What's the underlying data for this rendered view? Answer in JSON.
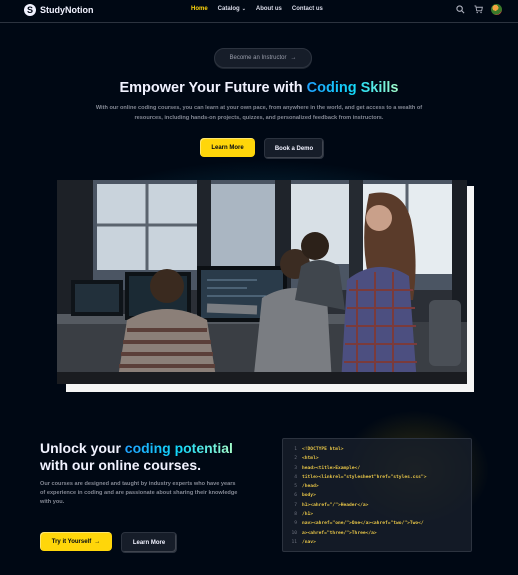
{
  "brand": {
    "name": "StudyNotion",
    "mark": "S"
  },
  "nav": {
    "items": [
      "Home",
      "Catalog",
      "About us",
      "Contact us"
    ],
    "active": "Home",
    "dropdown_glyph": "⌄"
  },
  "header_icons": [
    "search-icon",
    "cart-icon",
    "avatar"
  ],
  "hero": {
    "pill_label": "Become an Instructor",
    "pill_arrow": "→",
    "headline_prefix": "Empower Your Future with ",
    "headline_highlight": "Coding Skills",
    "subtext": "With our online coding courses, you can learn at your own pace, from anywhere in the world, and get access to a wealth of resources, including hands-on projects, quizzes, and personalized feedback from instructors.",
    "primary_button": "Learn More",
    "secondary_button": "Book a Demo"
  },
  "section": {
    "heading_prefix": "Unlock your ",
    "heading_highlight": "coding potential",
    "heading_suffix": " with our online courses.",
    "body": "Our courses are designed and taught by industry experts who have years of experience in coding and are passionate about sharing their knowledge with you.",
    "primary_button": "Try it Yourself",
    "primary_arrow": "→",
    "secondary_button": "Learn More"
  },
  "code_block": {
    "line_numbers": [
      "1",
      "2",
      "3",
      "4",
      "5",
      "6",
      "7",
      "8",
      "9",
      "10",
      "11"
    ],
    "lines": [
      "<!DOCTYPE html>",
      "<html>",
      "head><title>Example</",
      "title><linkrel=\"stylesheet\"href=\"styles.css\">",
      "/head>",
      "body>",
      "h1><ahref=\"/\">Header</a>",
      "/h1>",
      "nav><ahref=\"one/\">One</a><ahref=\"two/\">Two</",
      "a><ahref=\"three/\">Three</a>",
      "/nav>"
    ]
  },
  "colors": {
    "background": "#000814",
    "accent_yellow": "#ffd60a",
    "highlight_blue": "#12d8fa",
    "muted_text": "#838894",
    "code_yellow": "#e7c547"
  }
}
